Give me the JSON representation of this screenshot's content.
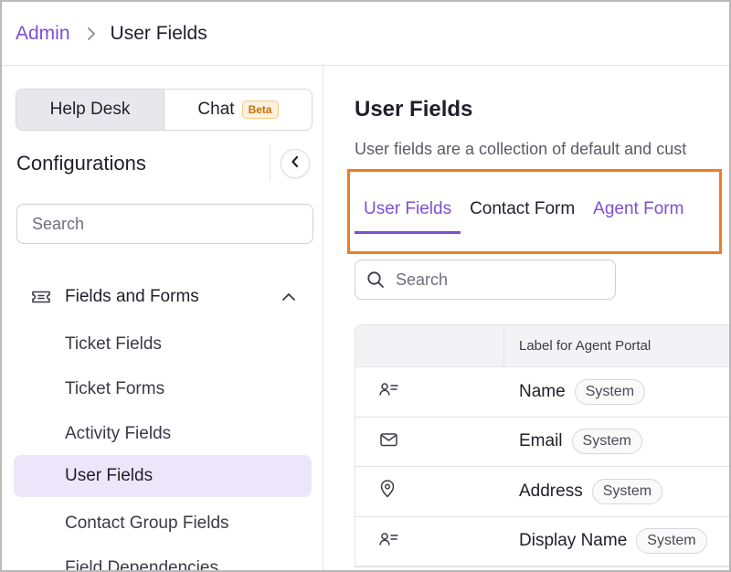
{
  "breadcrumb": {
    "parent": "Admin",
    "current": "User Fields"
  },
  "sidebar": {
    "segments": [
      {
        "label": "Help Desk"
      },
      {
        "label": "Chat",
        "badge": "Beta"
      }
    ],
    "title": "Configurations",
    "search_placeholder": "Search",
    "group": {
      "label": "Fields and Forms",
      "icon": "ticket-icon"
    },
    "items": [
      {
        "label": "Ticket Fields"
      },
      {
        "label": "Ticket Forms"
      },
      {
        "label": "Activity Fields"
      },
      {
        "label": "User Fields"
      },
      {
        "label": "Contact Group Fields"
      },
      {
        "label": "Field Dependencies"
      }
    ]
  },
  "main": {
    "title": "User Fields",
    "description": "User fields are a collection of default and cust",
    "tabs": [
      {
        "label": "User Fields"
      },
      {
        "label": "Contact Form"
      },
      {
        "label": "Agent Form"
      }
    ],
    "search_placeholder": "Search",
    "table": {
      "column_header": "Label for Agent Portal",
      "rows": [
        {
          "icon": "contact-card-icon",
          "name": "Name",
          "badge": "System"
        },
        {
          "icon": "mail-icon",
          "name": "Email",
          "badge": "System"
        },
        {
          "icon": "location-pin-icon",
          "name": "Address",
          "badge": "System"
        },
        {
          "icon": "contact-card-icon",
          "name": "Display Name",
          "badge": "System"
        }
      ]
    }
  },
  "colors": {
    "accent": "#7b4fd6",
    "highlight_box": "#f07c22",
    "active_nav_bg": "#ece6fa"
  }
}
